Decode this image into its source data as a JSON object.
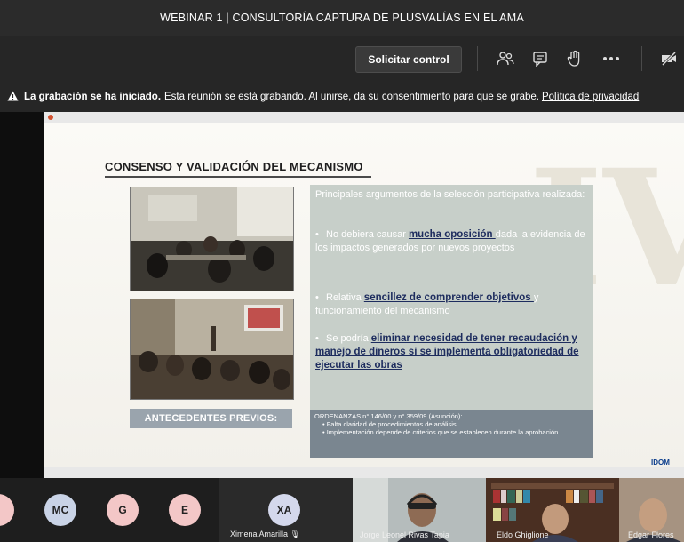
{
  "window": {
    "title": "WEBINAR 1 | CONSULTORÍA CAPTURA DE PLUSVALÍAS EN EL AMA"
  },
  "toolbar": {
    "request_control": "Solicitar control",
    "icons": [
      "participants-icon",
      "chat-icon",
      "raise-hand-icon",
      "more-icon",
      "camera-off-icon"
    ]
  },
  "notice": {
    "bold": "La grabación se ha iniciado.",
    "text": "Esta reunión se está grabando. Al unirse, da su consentimiento para que se grabe.",
    "link": "Política de privacidad"
  },
  "slide": {
    "roman": "IV",
    "title": "CONSENSO Y VALIDACIÓN DEL MECANISMO",
    "intro": "Principales argumentos de la selección participativa realizada:",
    "bullets": [
      {
        "pre": "No debiera causar ",
        "hl": "mucha oposición ",
        "post": "dada la evidencia de los impactos generados por nuevos proyectos"
      },
      {
        "pre": "Relativa ",
        "hl": "sencillez de comprender objetivos ",
        "post": "y funcionamiento del mecanismo"
      },
      {
        "pre": "Se podría ",
        "hl": "eliminar necesidad de tener recaudación y manejo de dineros si se implementa obligatoriedad de ejecutar las obras",
        "post": ""
      }
    ],
    "antecedentes": "ANTECEDENTES PREVIOS:",
    "ordenanzas": {
      "head": "ORDENANZAS n° 146/00 y n° 359/09 (Asunción):",
      "items": [
        "Falta claridad de procedimientos de análisis",
        "Implementación depende de criterios que se establecen durante la aprobación."
      ]
    },
    "logo": "IDOM"
  },
  "participants": [
    {
      "initials": "MC",
      "color": "#c9d3e6"
    },
    {
      "initials": "G",
      "color": "#f3c7c7"
    },
    {
      "initials": "E",
      "color": "#f3c7c7"
    },
    {
      "initials": "XA",
      "color": "#d4d8ec",
      "name": "Ximena Amarilla"
    },
    {
      "name": "Jorge Leonel Rivas Tapia"
    },
    {
      "name": "Eldo Ghiglione"
    },
    {
      "name": "Edgar Flores"
    }
  ]
}
